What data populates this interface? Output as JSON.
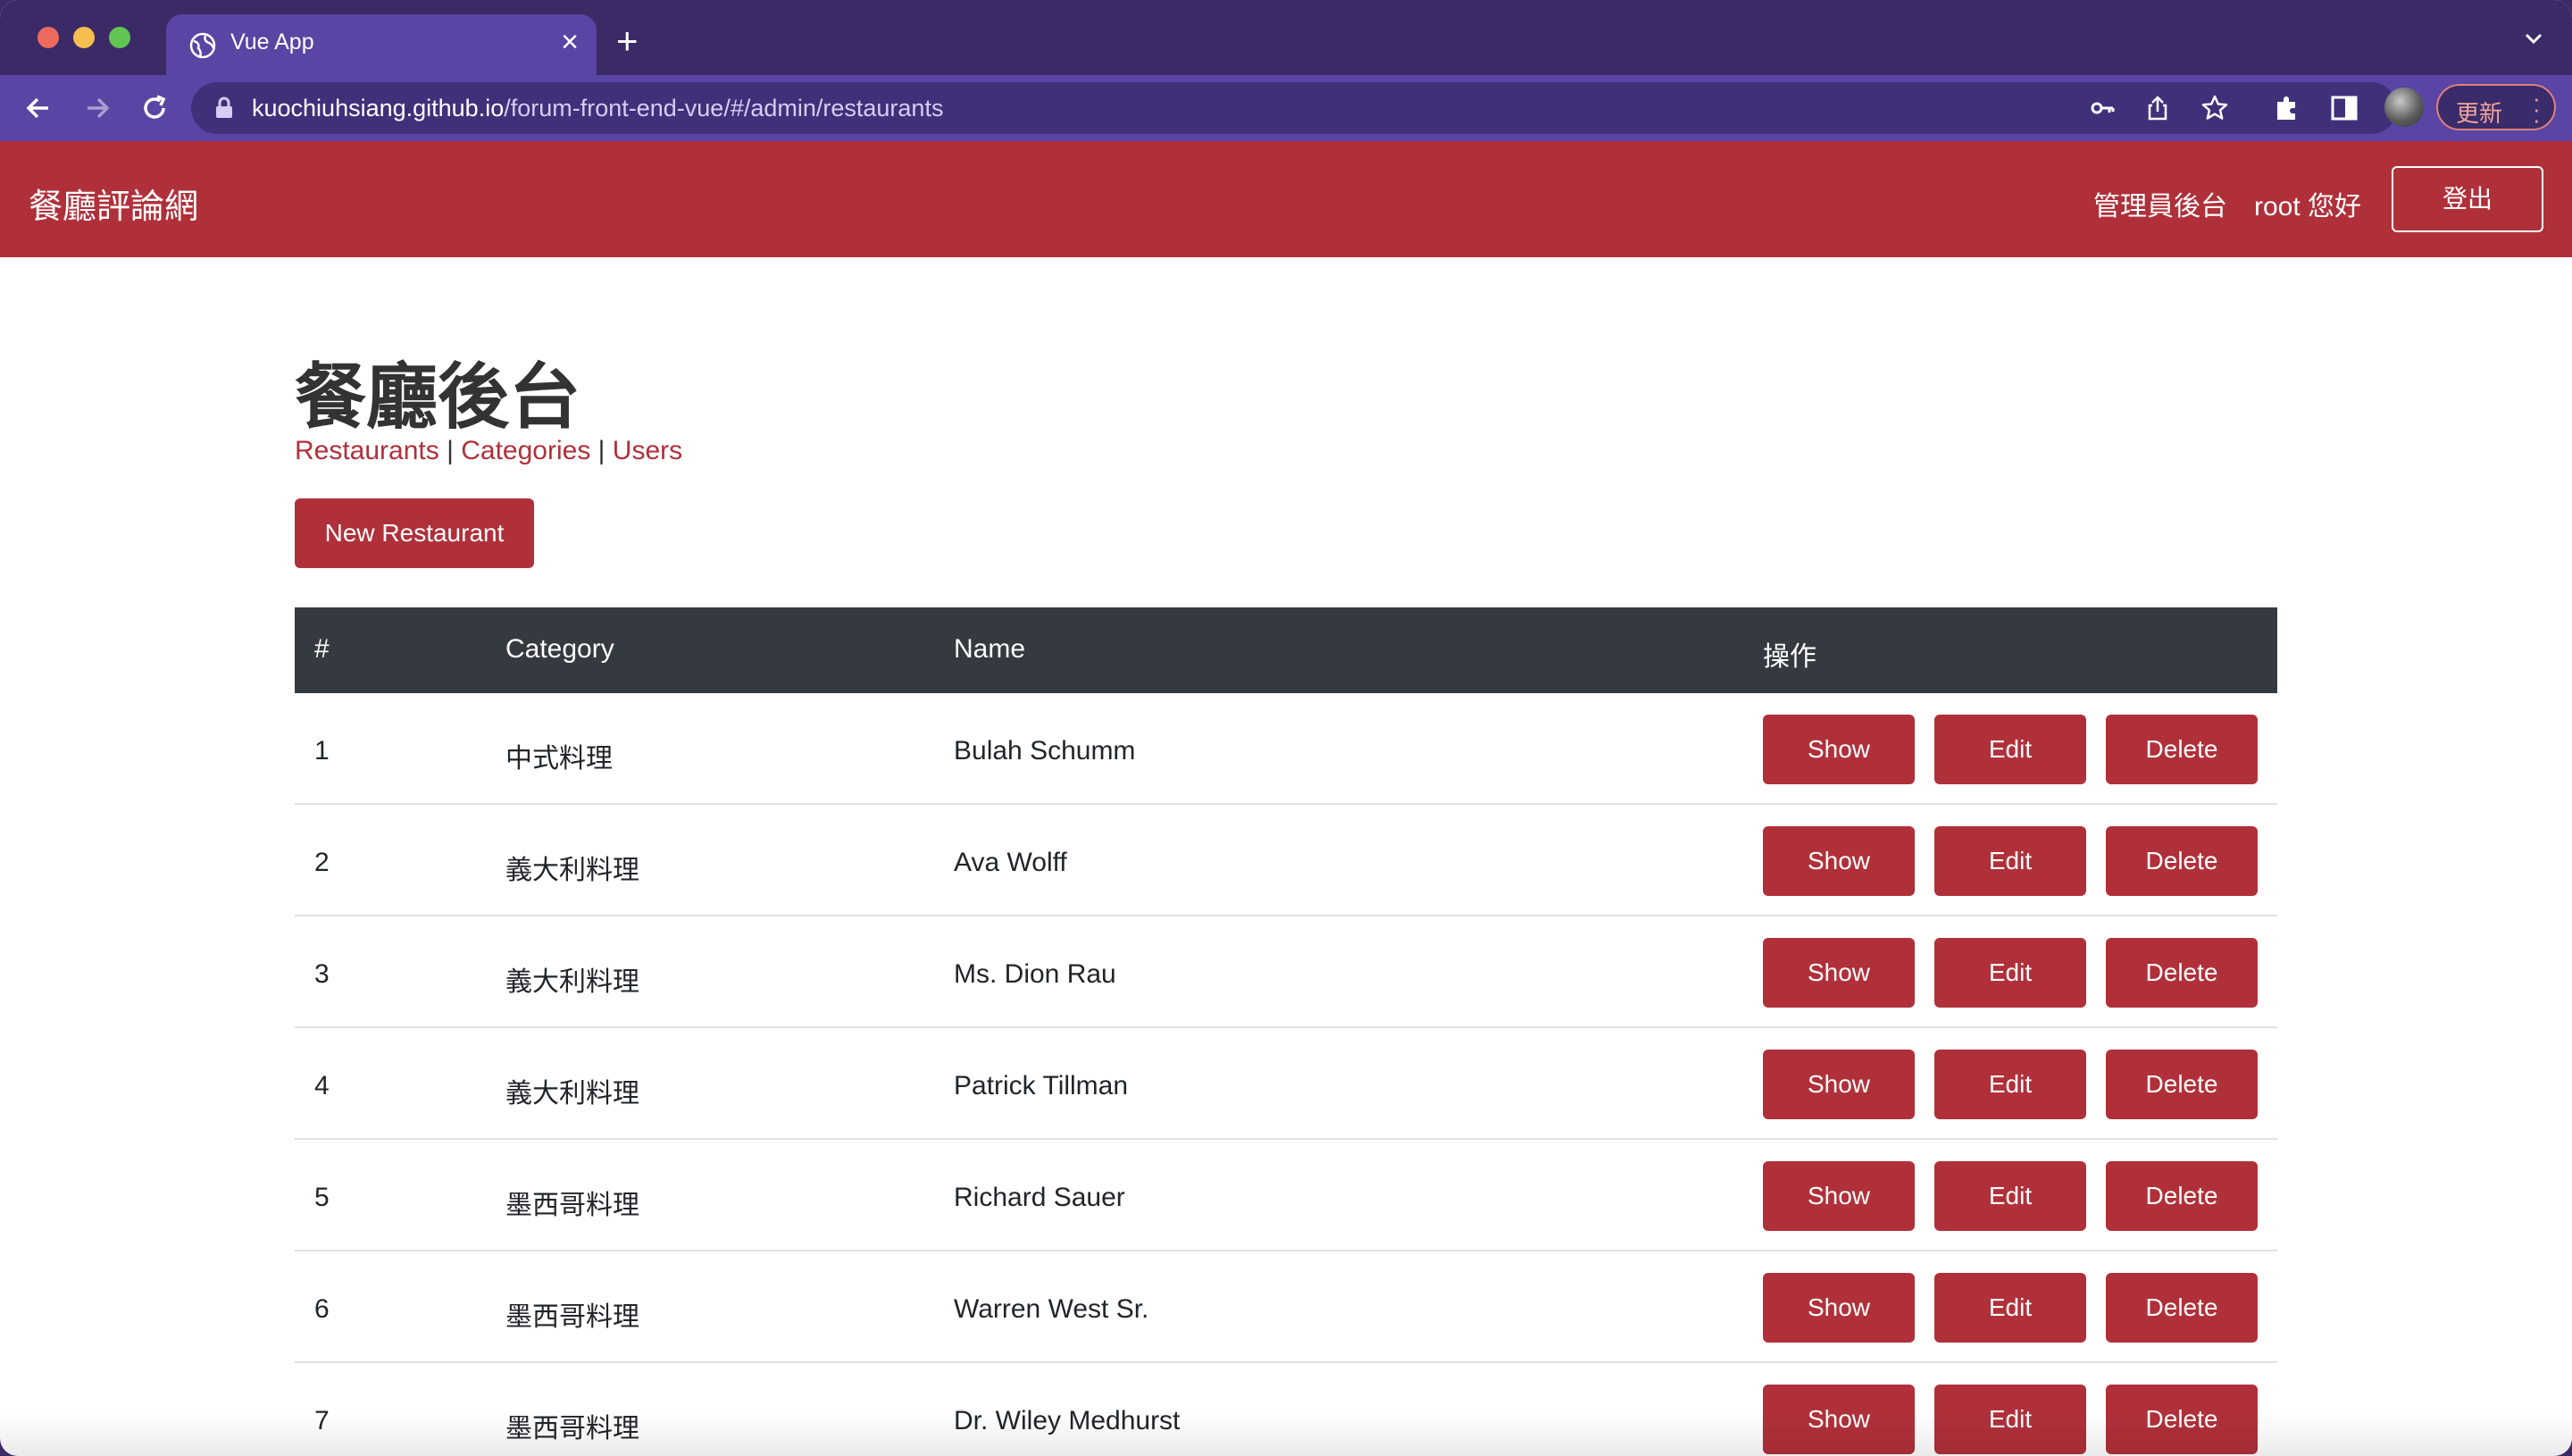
{
  "browser": {
    "tab_title": "Vue App",
    "url_host": "kuochiuhsiang.github.io",
    "url_path": "/forum-front-end-vue/#/admin/restaurants",
    "update_label": "更新"
  },
  "navbar": {
    "brand": "餐廳評論網",
    "admin_link": "管理員後台",
    "greeting": "root 您好",
    "logout": "登出"
  },
  "page": {
    "title": "餐廳後台",
    "links": [
      "Restaurants",
      "Categories",
      "Users"
    ],
    "separator": "|",
    "new_button": "New Restaurant"
  },
  "table": {
    "headers": [
      "#",
      "Category",
      "Name",
      "操作"
    ],
    "rows": [
      {
        "id": "1",
        "category": "中式料理",
        "name": "Bulah Schumm"
      },
      {
        "id": "2",
        "category": "義大利料理",
        "name": "Ava Wolff"
      },
      {
        "id": "3",
        "category": "義大利料理",
        "name": "Ms. Dion Rau"
      },
      {
        "id": "4",
        "category": "義大利料理",
        "name": "Patrick Tillman"
      },
      {
        "id": "5",
        "category": "墨西哥料理",
        "name": "Richard Sauer"
      },
      {
        "id": "6",
        "category": "墨西哥料理",
        "name": "Warren West Sr."
      },
      {
        "id": "7",
        "category": "墨西哥料理",
        "name": "Dr. Wiley Medhurst"
      }
    ],
    "actions": {
      "show": "Show",
      "edit": "Edit",
      "delete": "Delete"
    }
  },
  "colors": {
    "brand_red": "#b0303a",
    "browser_frame": "#3b2a66",
    "browser_toolbar": "#5a44a4",
    "table_header": "#343a40"
  }
}
